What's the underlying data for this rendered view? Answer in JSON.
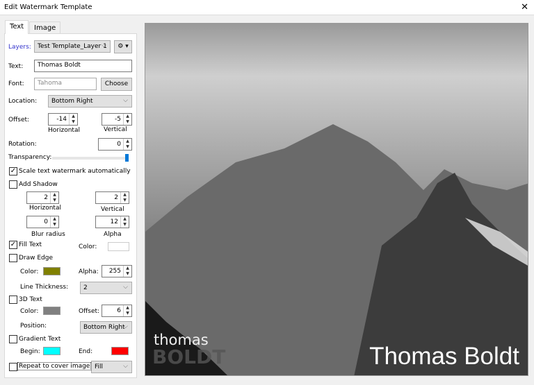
{
  "window": {
    "title": "Edit Watermark Template",
    "close": "✕"
  },
  "tabs": [
    {
      "label": "Text"
    },
    {
      "label": "Image"
    }
  ],
  "layers": {
    "label": "Layers:",
    "value": "Test Template_Layer 1",
    "gear": "⚙ ▾"
  },
  "text": {
    "label": "Text:",
    "value": "Thomas Boldt"
  },
  "font": {
    "label": "Font:",
    "value": "Tahoma",
    "button": "Choose"
  },
  "location": {
    "label": "Location:",
    "value": "Bottom Right"
  },
  "offset": {
    "label": "Offset:",
    "horizontal": "-14",
    "vertical": "-5",
    "h_label": "Horizontal",
    "v_label": "Vertical"
  },
  "rotation": {
    "label": "Rotation:",
    "value": "0"
  },
  "transparency": {
    "label": "Transparency:",
    "value": 1.0
  },
  "scale": {
    "label": "Scale text watermark automatically",
    "checked": true
  },
  "shadow": {
    "label": "Add Shadow",
    "checked": false,
    "horizontal": "2",
    "vertical": "2",
    "blur": "0",
    "alpha": "12",
    "h_label": "Horizontal",
    "v_label": "Vertical",
    "blur_label": "Blur radius",
    "alpha_label": "Alpha"
  },
  "fill": {
    "label": "Fill Text",
    "checked": true,
    "color_label": "Color:",
    "color": "#ffffff"
  },
  "edge": {
    "label": "Draw Edge",
    "checked": false,
    "color_label": "Color:",
    "color": "#808000",
    "alpha_label": "Alpha:",
    "alpha": "255",
    "thickness_label": "Line Thickness:",
    "thickness": "2"
  },
  "text3d": {
    "label": "3D Text",
    "checked": false,
    "color_label": "Color:",
    "color": "#808080",
    "offset_label": "Offset:",
    "offset": "6",
    "position_label": "Position:",
    "position": "Bottom Right"
  },
  "gradient": {
    "label": "Gradient Text",
    "checked": false,
    "begin_label": "Begin:",
    "begin": "#00ffff",
    "end_label": "End:",
    "end": "#ff0000"
  },
  "repeat": {
    "label": "Repeat to cover image",
    "checked": false,
    "mode": "Fill"
  },
  "preview": {
    "logo_top": "thomas",
    "logo_bottom": "BOLDT",
    "watermark": "Thomas Boldt"
  }
}
